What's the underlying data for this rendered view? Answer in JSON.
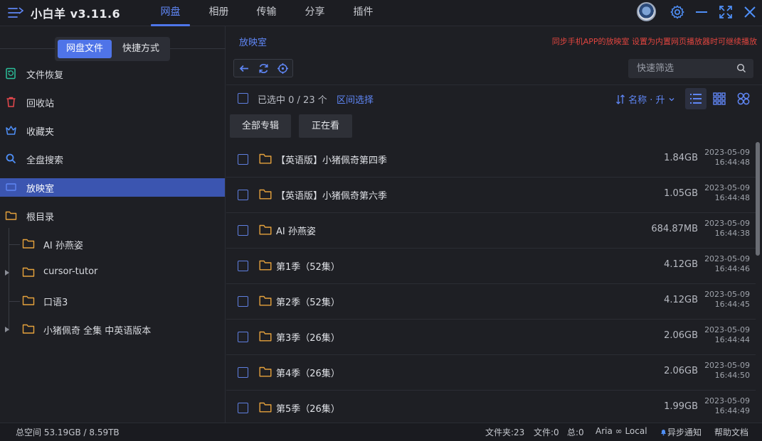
{
  "app": {
    "title": "小白羊 v3.11.6"
  },
  "tabs": [
    {
      "label": "网盘",
      "active": true
    },
    {
      "label": "相册"
    },
    {
      "label": "传输"
    },
    {
      "label": "分享"
    },
    {
      "label": "插件"
    }
  ],
  "window_icons": [
    "gear-icon",
    "minimize-icon",
    "fullscreen-icon",
    "close-icon"
  ],
  "sidebar": {
    "segments": [
      {
        "label": "网盘文件",
        "active": true
      },
      {
        "label": "快捷方式"
      }
    ],
    "items": [
      {
        "label": "文件恢复",
        "icon": "restore-icon",
        "color": "#2bbf9a"
      },
      {
        "label": "回收站",
        "icon": "trash-icon",
        "color": "#e5484d"
      },
      {
        "label": "收藏夹",
        "icon": "crown-icon",
        "color": "#4f8ff7"
      },
      {
        "label": "全盘搜索",
        "icon": "search-icon",
        "color": "#4f8ff7"
      },
      {
        "label": "放映室",
        "icon": "tv-icon",
        "color": "#4f74e8",
        "active": true
      },
      {
        "label": "根目录",
        "icon": "folder-icon",
        "color": "#e6a23c"
      }
    ],
    "tree": [
      {
        "label": "AI 孙燕姿",
        "expandable": false
      },
      {
        "label": "cursor-tutor",
        "expandable": true
      },
      {
        "label": "口语3",
        "expandable": false
      },
      {
        "label": "小猪佩奇 全集 中英语版本",
        "expandable": true
      }
    ]
  },
  "main": {
    "breadcrumb": "放映室",
    "notice": "同步手机APP的放映室 设置为内置网页播放器时可继续播放",
    "filter_placeholder": "快速筛选",
    "selection": "已选中 0 / 23 个",
    "range_select": "区间选择",
    "sort": "名称 · 升",
    "filter_tabs": [
      "全部专辑",
      "正在看"
    ],
    "rows": [
      {
        "name": "【英语版】小猪佩奇第四季",
        "size": "1.84GB",
        "date": "2023-05-09",
        "time": "16:44:48"
      },
      {
        "name": "【英语版】小猪佩奇第六季",
        "size": "1.05GB",
        "date": "2023-05-09",
        "time": "16:44:48"
      },
      {
        "name": "AI 孙燕姿",
        "size": "684.87MB",
        "date": "2023-05-09",
        "time": "16:44:38"
      },
      {
        "name": "第1季（52集）",
        "size": "4.12GB",
        "date": "2023-05-09",
        "time": "16:44:46"
      },
      {
        "name": "第2季（52集）",
        "size": "4.12GB",
        "date": "2023-05-09",
        "time": "16:44:45"
      },
      {
        "name": "第3季（26集）",
        "size": "2.06GB",
        "date": "2023-05-09",
        "time": "16:44:44"
      },
      {
        "name": "第4季（26集）",
        "size": "2.06GB",
        "date": "2023-05-09",
        "time": "16:44:50"
      },
      {
        "name": "第5季（26集）",
        "size": "1.99GB",
        "date": "2023-05-09",
        "time": "16:44:49"
      }
    ]
  },
  "status": {
    "space": "总空间 53.19GB / 8.59TB",
    "folders": "文件夹:23",
    "files": "文件:0",
    "total": "总:0",
    "aria": "Aria ∞ Local",
    "async": "异步通知",
    "help": "帮助文档"
  },
  "colors": {
    "accent": "#4f74e8",
    "folder": "#e6a23c",
    "notice": "#e0453f"
  }
}
